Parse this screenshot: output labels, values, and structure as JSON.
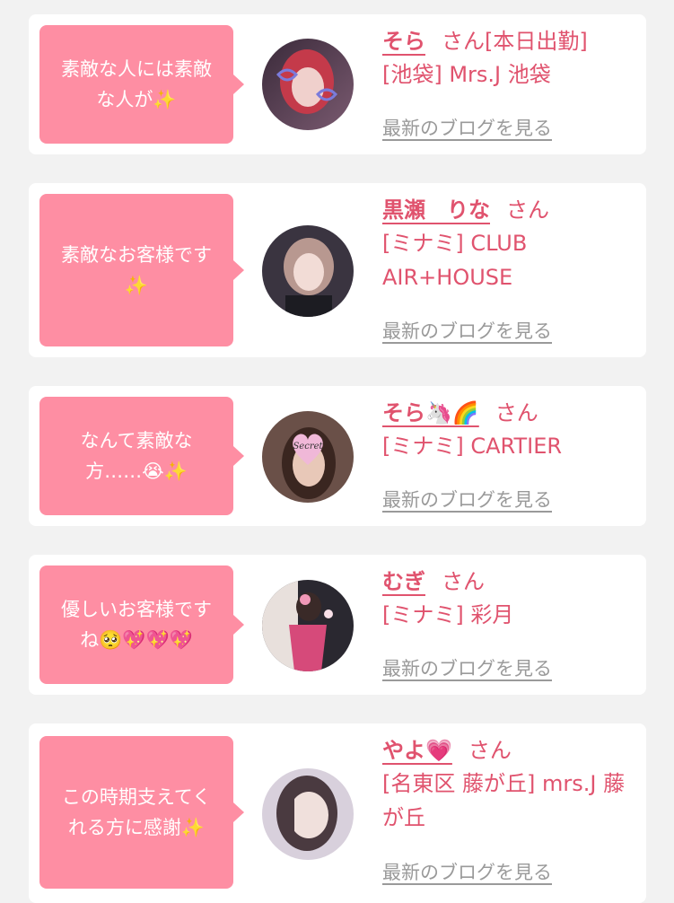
{
  "theme": {
    "accent": "#e0536e",
    "bubble": "#fe8ea3",
    "card": "#ffffff",
    "bg": "#f2f2f2",
    "link_gray": "#9a9a9a"
  },
  "cards": [
    {
      "comment": "素敵な人には素敵な人が✨",
      "name": "そら",
      "suffix": "さん[本日出勤]",
      "shop": "[池袋] Mrs.J 池袋",
      "blog_link": "最新のブログを見る"
    },
    {
      "comment": "素敵なお客様です✨",
      "name": "黒瀬　りな",
      "suffix": "さん",
      "shop": "[ミナミ] CLUB AIR+HOUSE",
      "blog_link": "最新のブログを見る"
    },
    {
      "comment": "なんて素敵な方……😭✨",
      "name": "そら🦄🌈",
      "suffix": "さん",
      "shop": "[ミナミ] CARTIER",
      "blog_link": "最新のブログを見る",
      "avatar_text": "Secret"
    },
    {
      "comment": "優しいお客様です ね🥺💖💖💖",
      "name": "むぎ",
      "suffix": "さん",
      "shop": "[ミナミ] 彩月",
      "blog_link": "最新のブログを見る"
    },
    {
      "comment": "この時期支えてくれる方に感謝✨",
      "name": "やよ💗",
      "suffix": "さん",
      "shop": "[名東区 藤が丘] mrs.J 藤が丘",
      "blog_link": "最新のブログを見る"
    }
  ]
}
